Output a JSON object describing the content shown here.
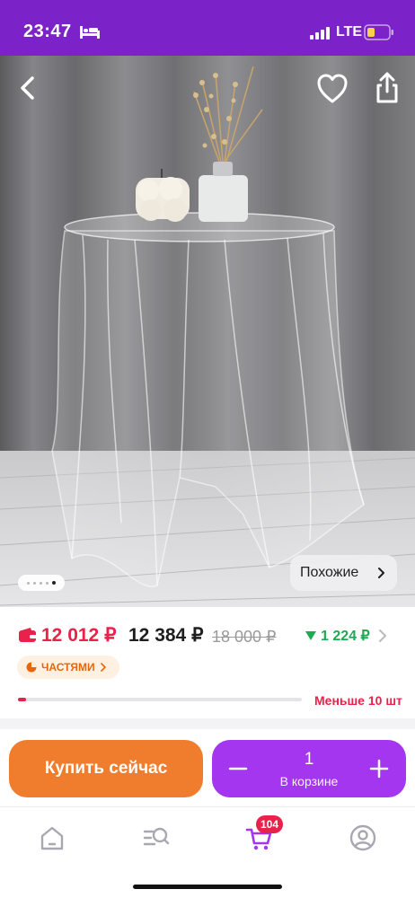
{
  "status_bar": {
    "time": "23:47",
    "network": "LTE",
    "icons": [
      "bed-icon",
      "signal-icon",
      "battery-icon"
    ],
    "background": "#7b22c8"
  },
  "gallery": {
    "image_count": 5,
    "active_index": 4,
    "similar_label": "Похожие",
    "icons": [
      "back-arrow-icon",
      "heart-icon",
      "share-icon",
      "chevron-right-icon"
    ]
  },
  "pricing": {
    "card_price": "12 012 ₽",
    "regular_price": "12 384 ₽",
    "old_price": "18 000 ₽",
    "cashback": "1 224 ₽",
    "installments_label": "ЧАСТЯМИ",
    "stock_label": "Меньше 10 шт",
    "stock_level": 0.03,
    "colors": {
      "accent_red": "#e8224a",
      "cashback_green": "#1eaa52",
      "installments_orange": "#e8650a"
    }
  },
  "actions": {
    "buy_now": "Купить сейчас",
    "quantity": "1",
    "in_cart_label": "В корзине",
    "colors": {
      "buy": "#f07d2e",
      "cart": "#a436f0"
    }
  },
  "tab_bar": {
    "tabs": [
      "home-icon",
      "catalog-search-icon",
      "cart-icon",
      "profile-icon"
    ],
    "cart_count": "104",
    "active_tab": "cart-icon"
  }
}
